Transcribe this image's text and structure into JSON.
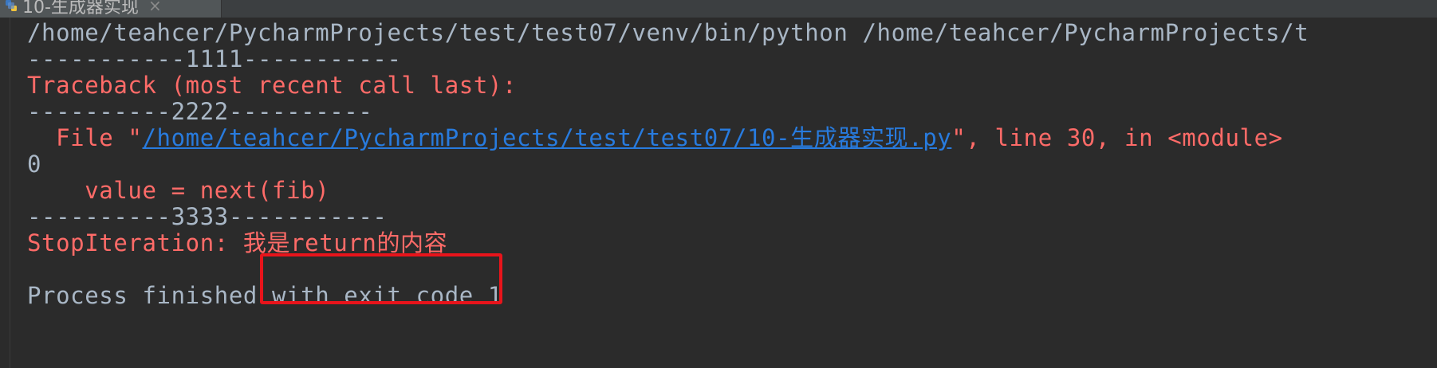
{
  "tab": {
    "title": "10-生成器实现",
    "close": "×",
    "icon": "python-file-icon"
  },
  "console": {
    "lines": [
      {
        "kind": "out",
        "text": "/home/teahcer/PycharmProjects/test/test07/venv/bin/python /home/teahcer/PycharmProjects/t"
      },
      {
        "kind": "out",
        "text": "-----------1111-----------"
      },
      {
        "kind": "err",
        "text": "Traceback (most recent call last):"
      },
      {
        "kind": "out",
        "text": "----------2222----------"
      },
      {
        "kind": "file",
        "prefix": "  File \"",
        "link": "/home/teahcer/PycharmProjects/test/test07/10-生成器实现.py",
        "suffix": "\", line 30, in <module>"
      },
      {
        "kind": "out",
        "text": "0"
      },
      {
        "kind": "err",
        "text": "    value = next(fib)"
      },
      {
        "kind": "out",
        "text": "----------3333-----------"
      },
      {
        "kind": "err",
        "text": "StopIteration: 我是return的内容"
      },
      {
        "kind": "out",
        "text": ""
      },
      {
        "kind": "out",
        "text": "Process finished with exit code 1"
      }
    ]
  },
  "colors": {
    "background": "#2b2b2b",
    "stdout": "#a9b7c6",
    "stderr": "#ff6b68",
    "link": "#287bde",
    "highlight_border": "#e8141b"
  }
}
